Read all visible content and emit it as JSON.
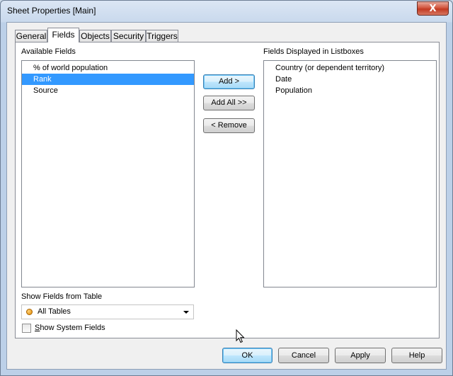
{
  "window": {
    "title": "Sheet Properties [Main]",
    "close_label": "X"
  },
  "tabs": [
    {
      "label": "General",
      "active": false
    },
    {
      "label": "Fields",
      "active": true
    },
    {
      "label": "Objects",
      "active": false
    },
    {
      "label": "Security",
      "active": false
    },
    {
      "label": "Triggers",
      "active": false
    }
  ],
  "available": {
    "label": "Available Fields",
    "items": [
      "% of world population",
      "Rank",
      "Source"
    ],
    "selected": "Rank"
  },
  "displayed": {
    "label": "Fields Displayed in Listboxes",
    "items": [
      "Country (or dependent territory)",
      "Date",
      "Population"
    ]
  },
  "middle_buttons": {
    "add": "Add >",
    "add_all": "Add All >>",
    "remove": "< Remove"
  },
  "show_fields": {
    "label": "Show Fields from Table",
    "value": "All Tables"
  },
  "system_fields": {
    "label": "Show System Fields",
    "checked": false
  },
  "footer": {
    "ok": "OK",
    "cancel": "Cancel",
    "apply": "Apply",
    "help": "Help"
  },
  "colors": {
    "selection": "#3399ff",
    "default_button_border": "#3c7fb1",
    "close_button": "#c23a22"
  }
}
